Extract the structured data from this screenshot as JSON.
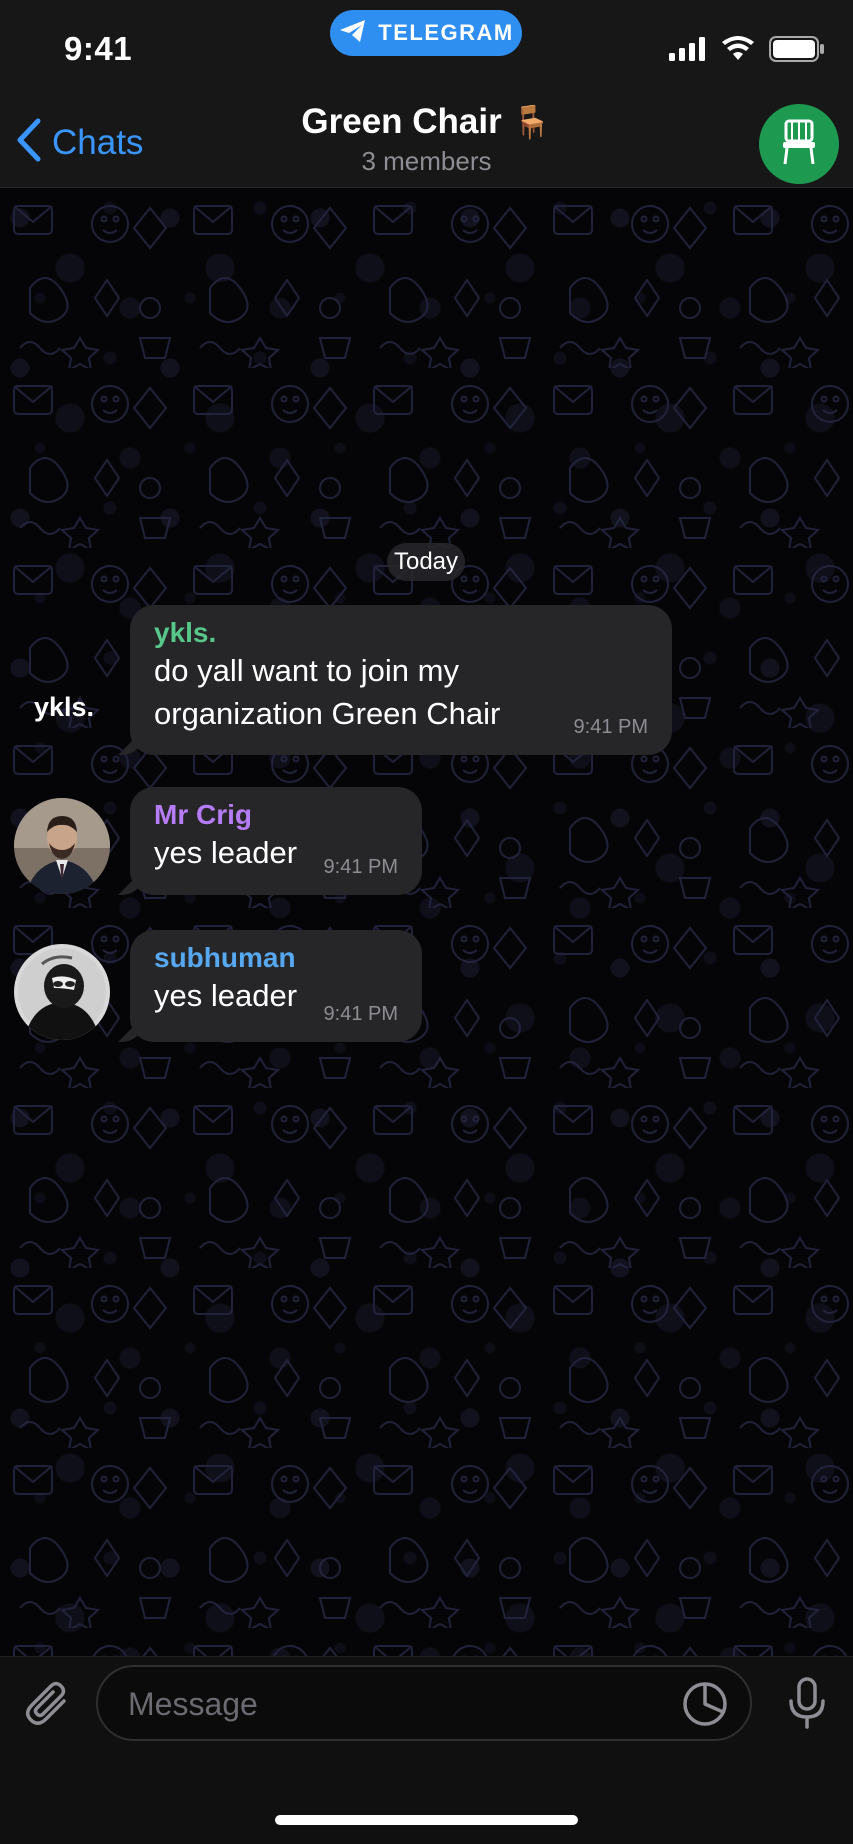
{
  "status_bar": {
    "time": "9:41",
    "app_pill_label": "TELEGRAM",
    "accent_color": "#2e8ff0"
  },
  "nav": {
    "back_label": "Chats",
    "title": "Green Chair",
    "title_emoji": "🪑",
    "subtitle": "3 members",
    "group_avatar_icon": "chair-icon",
    "group_avatar_color": "#1d9a50"
  },
  "chat": {
    "date_divider": "Today",
    "messages": [
      {
        "sender": "ykls.",
        "sender_color": "#58c78a",
        "avatar_text": "ykls.",
        "lines": [
          "do yall want to join my",
          "organization Green Chair"
        ],
        "time": "9:41 PM"
      },
      {
        "sender": "Mr Crig",
        "sender_color": "#b57cf6",
        "avatar": "photo-avatar-suit",
        "lines": [
          "yes leader"
        ],
        "time": "9:41 PM"
      },
      {
        "sender": "subhuman",
        "sender_color": "#56a8f0",
        "avatar": "photo-avatar-bw",
        "lines": [
          "yes leader"
        ],
        "time": "9:41 PM"
      }
    ]
  },
  "input": {
    "placeholder": "Message",
    "attach_icon": "paperclip-icon",
    "sticker_icon": "sticker-icon",
    "mic_icon": "microphone-icon"
  }
}
